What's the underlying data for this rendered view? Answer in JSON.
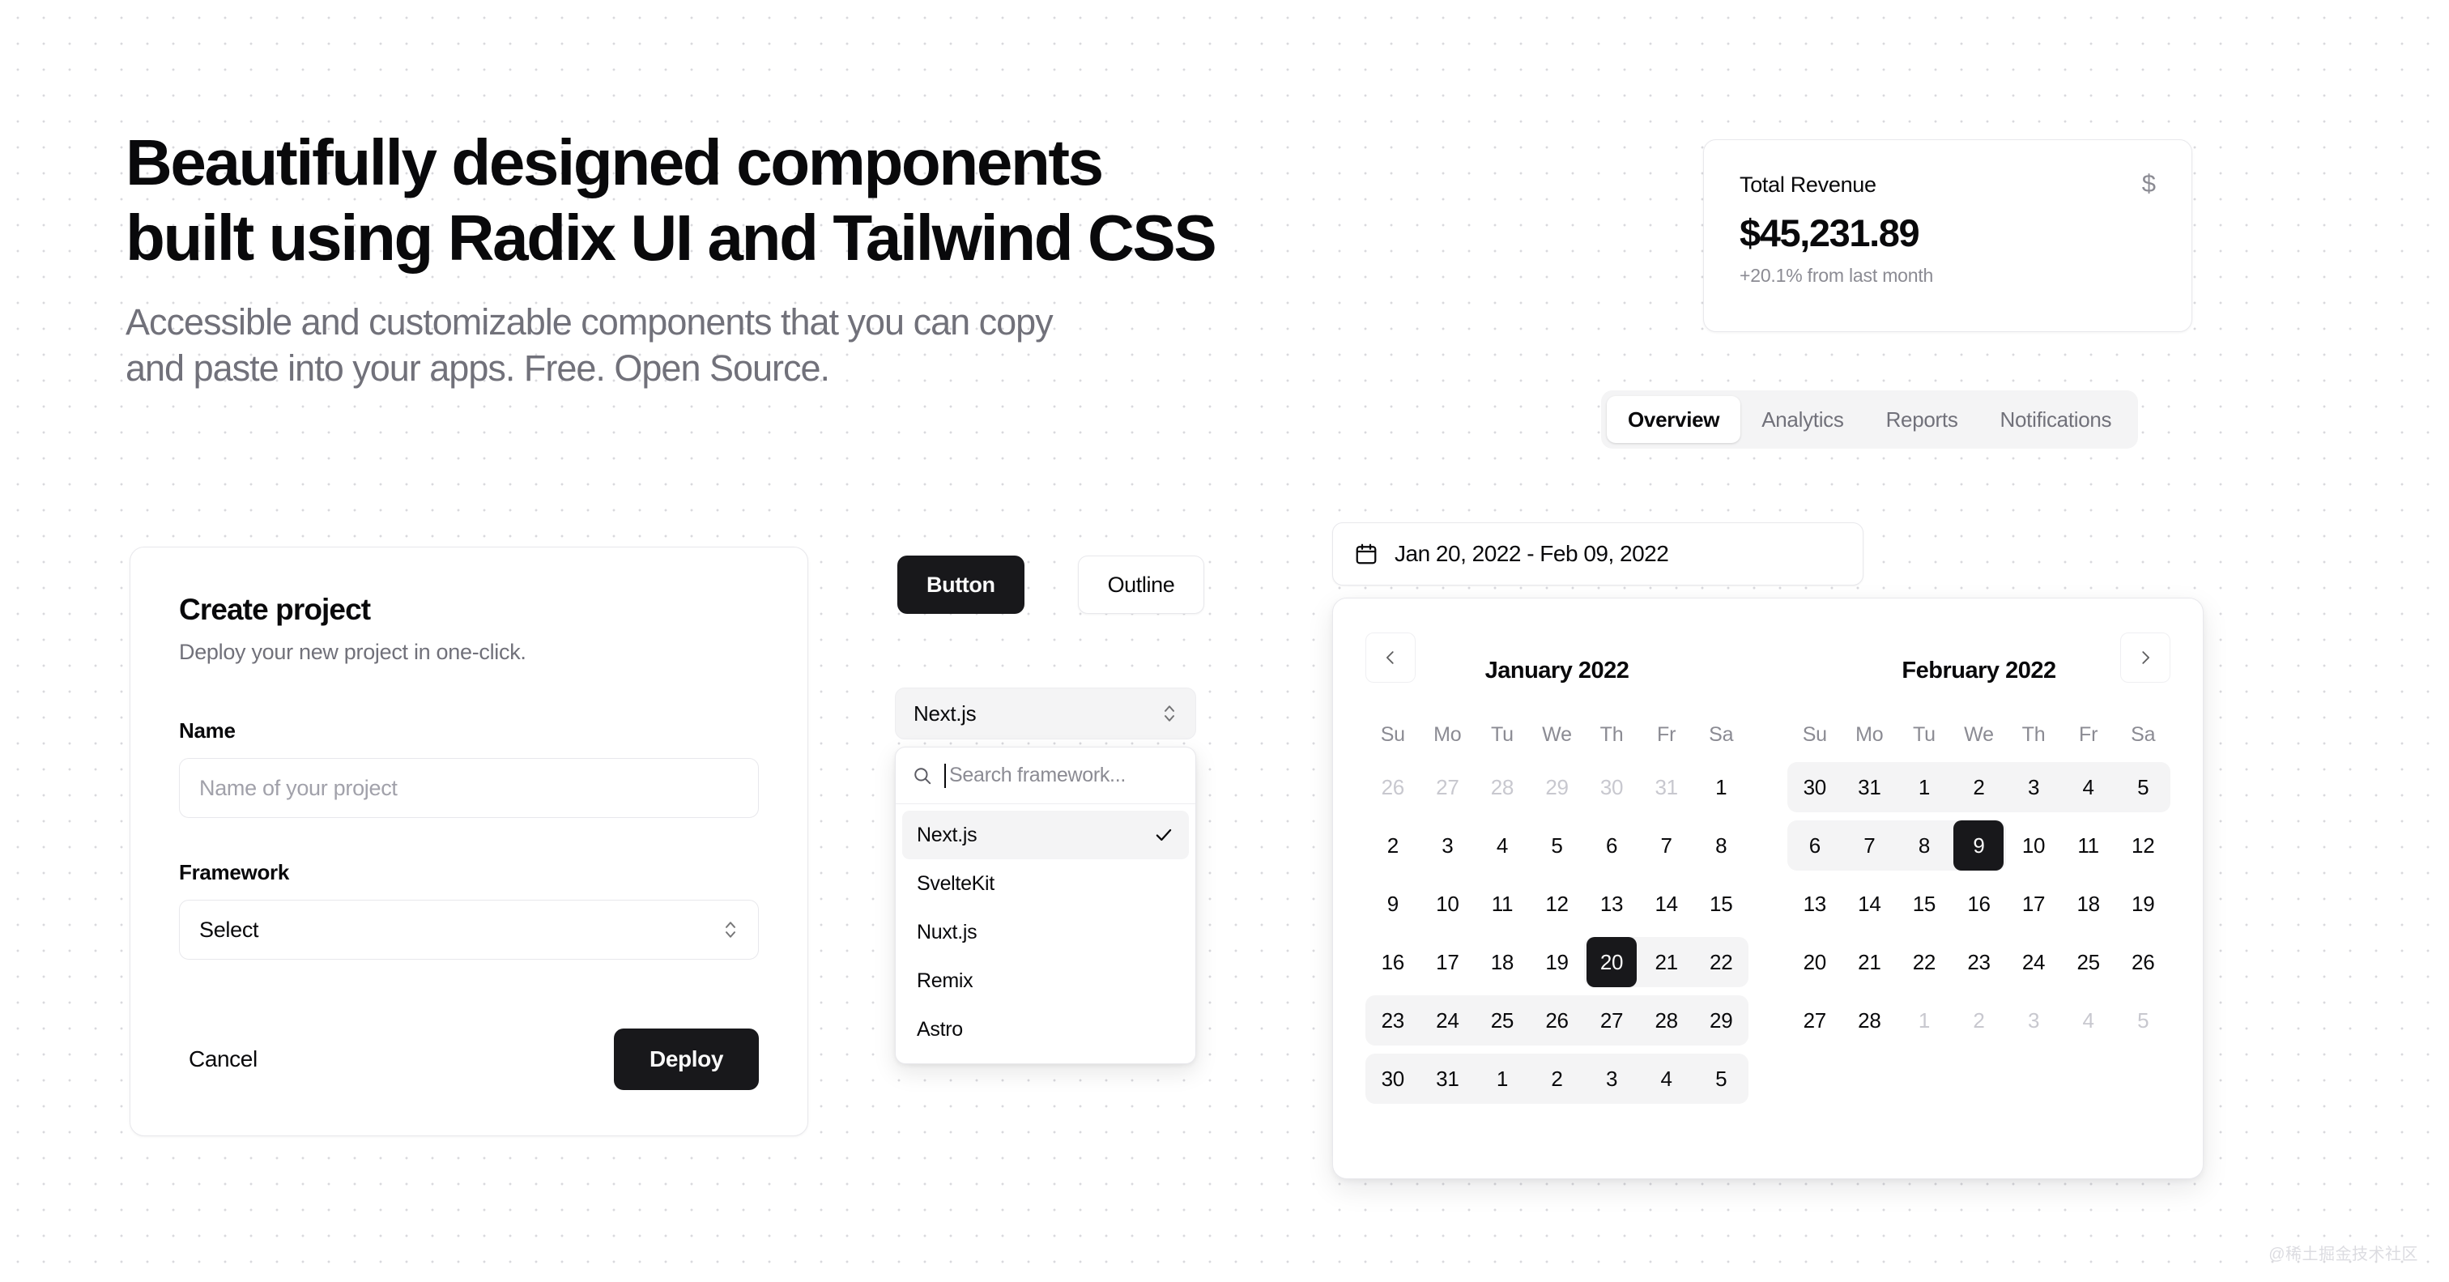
{
  "hero": {
    "heading_line1": "Beautifully designed components",
    "heading_line2": "built using Radix UI and Tailwind CSS",
    "subheading_line1": "Accessible and customizable components that you can copy",
    "subheading_line2": "and paste into your apps. Free. Open Source."
  },
  "revenue_card": {
    "title": "Total Revenue",
    "icon": "dollar-sign-icon",
    "icon_glyph": "$",
    "value": "$45,231.89",
    "delta": "+20.1% from last month"
  },
  "tabs": {
    "items": [
      {
        "label": "Overview",
        "active": true
      },
      {
        "label": "Analytics",
        "active": false
      },
      {
        "label": "Reports",
        "active": false
      },
      {
        "label": "Notifications",
        "active": false
      }
    ]
  },
  "create_card": {
    "title": "Create project",
    "description": "Deploy your new project in one-click.",
    "name_label": "Name",
    "name_placeholder": "Name of your project",
    "name_value": "",
    "framework_label": "Framework",
    "framework_value": "Select",
    "cancel_label": "Cancel",
    "deploy_label": "Deploy"
  },
  "buttons": {
    "primary_label": "Button",
    "outline_label": "Outline"
  },
  "combobox": {
    "trigger_value": "Next.js",
    "search_placeholder": "Search framework...",
    "search_value": "",
    "options": [
      {
        "label": "Next.js",
        "selected": true
      },
      {
        "label": "SvelteKit",
        "selected": false
      },
      {
        "label": "Nuxt.js",
        "selected": false
      },
      {
        "label": "Remix",
        "selected": false
      },
      {
        "label": "Astro",
        "selected": false
      }
    ]
  },
  "date_picker": {
    "range_label": "Jan 20, 2022 - Feb 09, 2022",
    "prev_label": "‹",
    "next_label": "›",
    "weekdays": [
      "Su",
      "Mo",
      "Tu",
      "We",
      "Th",
      "Fr",
      "Sa"
    ],
    "months": [
      {
        "caption": "January 2022",
        "weeks": [
          [
            {
              "d": "26",
              "outside": true
            },
            {
              "d": "27",
              "outside": true
            },
            {
              "d": "28",
              "outside": true
            },
            {
              "d": "29",
              "outside": true
            },
            {
              "d": "30",
              "outside": true
            },
            {
              "d": "31",
              "outside": true
            },
            {
              "d": "1",
              "outside": false
            }
          ],
          [
            {
              "d": "2"
            },
            {
              "d": "3"
            },
            {
              "d": "4"
            },
            {
              "d": "5"
            },
            {
              "d": "6"
            },
            {
              "d": "7"
            },
            {
              "d": "8"
            }
          ],
          [
            {
              "d": "9"
            },
            {
              "d": "10"
            },
            {
              "d": "11"
            },
            {
              "d": "12"
            },
            {
              "d": "13"
            },
            {
              "d": "14"
            },
            {
              "d": "15"
            }
          ],
          [
            {
              "d": "16"
            },
            {
              "d": "17"
            },
            {
              "d": "18"
            },
            {
              "d": "19"
            },
            {
              "d": "20",
              "selected": true,
              "range": "first"
            },
            {
              "d": "21",
              "range": "mid"
            },
            {
              "d": "22",
              "range": "last"
            }
          ],
          [
            {
              "d": "23",
              "range": "first"
            },
            {
              "d": "24",
              "range": "mid"
            },
            {
              "d": "25",
              "range": "mid"
            },
            {
              "d": "26",
              "range": "mid"
            },
            {
              "d": "27",
              "range": "mid"
            },
            {
              "d": "28",
              "range": "mid"
            },
            {
              "d": "29",
              "range": "last"
            }
          ],
          [
            {
              "d": "30",
              "range": "first"
            },
            {
              "d": "31",
              "range": "mid"
            },
            {
              "d": "1",
              "range": "mid"
            },
            {
              "d": "2",
              "range": "mid"
            },
            {
              "d": "3",
              "range": "mid"
            },
            {
              "d": "4",
              "range": "mid"
            },
            {
              "d": "5",
              "range": "last"
            }
          ]
        ]
      },
      {
        "caption": "February 2022",
        "weeks": [
          [
            {
              "d": "30",
              "range": "first"
            },
            {
              "d": "31",
              "range": "mid"
            },
            {
              "d": "1",
              "range": "mid"
            },
            {
              "d": "2",
              "range": "mid"
            },
            {
              "d": "3",
              "range": "mid"
            },
            {
              "d": "4",
              "range": "mid"
            },
            {
              "d": "5",
              "range": "last"
            }
          ],
          [
            {
              "d": "6",
              "range": "first"
            },
            {
              "d": "7",
              "range": "mid"
            },
            {
              "d": "8",
              "range": "mid"
            },
            {
              "d": "9",
              "selected": true,
              "range": "last"
            },
            {
              "d": "10"
            },
            {
              "d": "11"
            },
            {
              "d": "12"
            }
          ],
          [
            {
              "d": "13"
            },
            {
              "d": "14"
            },
            {
              "d": "15"
            },
            {
              "d": "16"
            },
            {
              "d": "17"
            },
            {
              "d": "18"
            },
            {
              "d": "19"
            }
          ],
          [
            {
              "d": "20"
            },
            {
              "d": "21"
            },
            {
              "d": "22"
            },
            {
              "d": "23"
            },
            {
              "d": "24"
            },
            {
              "d": "25"
            },
            {
              "d": "26"
            }
          ],
          [
            {
              "d": "27"
            },
            {
              "d": "28"
            },
            {
              "d": "1",
              "outside": true
            },
            {
              "d": "2",
              "outside": true
            },
            {
              "d": "3",
              "outside": true
            },
            {
              "d": "4",
              "outside": true
            },
            {
              "d": "5",
              "outside": true
            }
          ]
        ]
      }
    ]
  },
  "watermark": {
    "text": "@稀土掘金技术社区"
  }
}
